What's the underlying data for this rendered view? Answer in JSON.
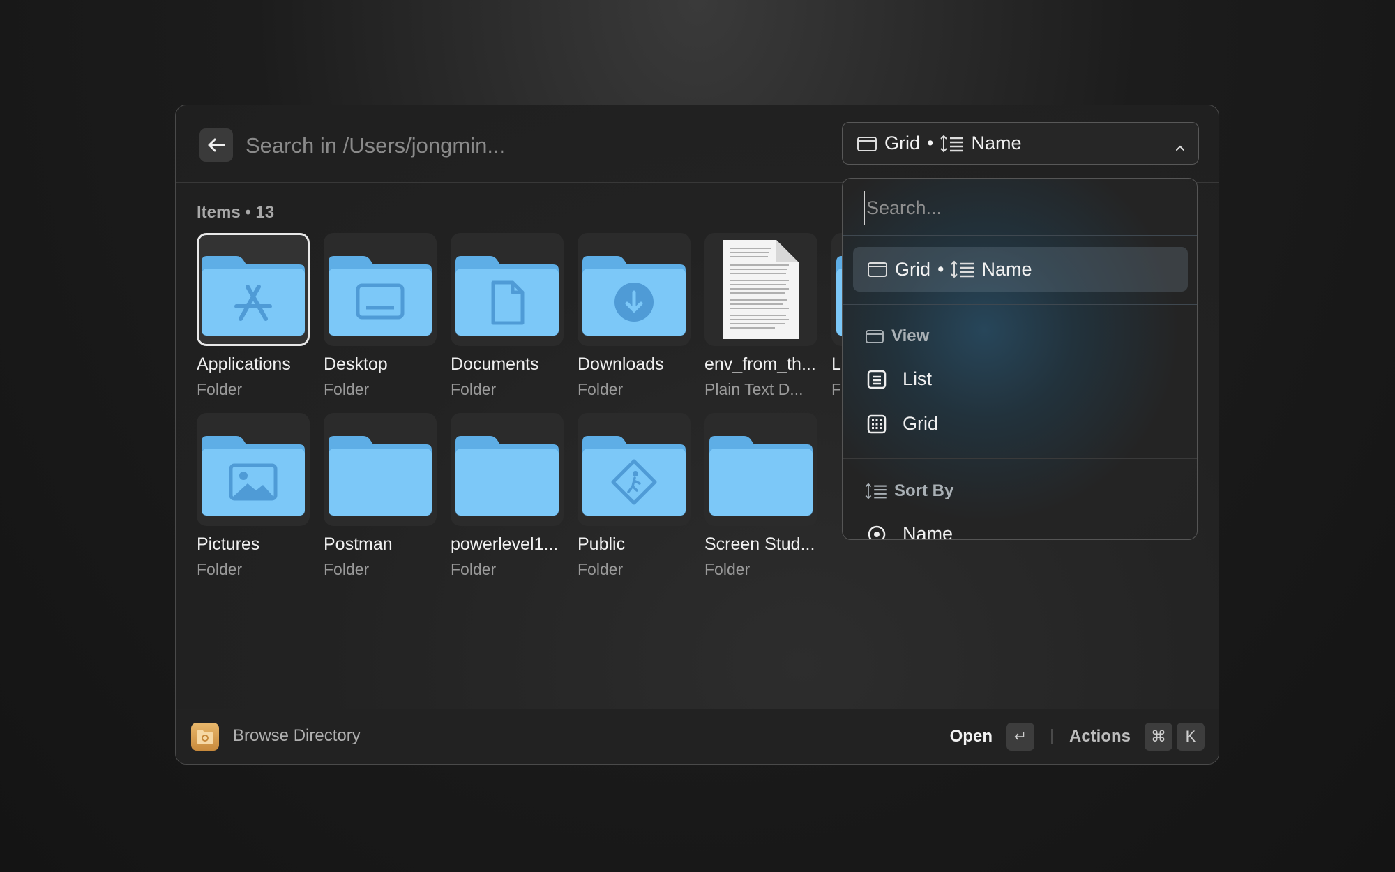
{
  "header": {
    "search_placeholder": "Search in /Users/jongmin...",
    "dropdown": {
      "view": "Grid",
      "separator": "•",
      "sort": "Name"
    }
  },
  "items_count_label": "Items • 13",
  "items": [
    {
      "name": "Applications",
      "kind": "Folder",
      "icon": "applications-folder-icon",
      "selected": true
    },
    {
      "name": "Desktop",
      "kind": "Folder",
      "icon": "desktop-folder-icon"
    },
    {
      "name": "Documents",
      "kind": "Folder",
      "icon": "documents-folder-icon"
    },
    {
      "name": "Downloads",
      "kind": "Folder",
      "icon": "downloads-folder-icon"
    },
    {
      "name": "env_from_th...",
      "kind": "Plain Text D...",
      "icon": "text-document-icon"
    },
    {
      "name": "L",
      "kind": "F",
      "icon": "folder-icon"
    },
    {
      "name": "Pictures",
      "kind": "Folder",
      "icon": "pictures-folder-icon"
    },
    {
      "name": "Postman",
      "kind": "Folder",
      "icon": "folder-icon"
    },
    {
      "name": "powerlevel1...",
      "kind": "Folder",
      "icon": "folder-icon"
    },
    {
      "name": "Public",
      "kind": "Folder",
      "icon": "public-folder-icon"
    },
    {
      "name": "Screen Stud...",
      "kind": "Folder",
      "icon": "folder-icon"
    }
  ],
  "dropdown_panel": {
    "search_placeholder": "Search...",
    "selected": {
      "view": "Grid",
      "separator": "•",
      "sort": "Name"
    },
    "view_section": "View",
    "view_options": [
      "List",
      "Grid"
    ],
    "sort_section": "Sort By",
    "sort_options": [
      "Name"
    ]
  },
  "footer": {
    "title": "Browse Directory",
    "open_label": "Open",
    "enter_key": "↵",
    "actions_label": "Actions",
    "cmd_key": "⌘",
    "k_key": "K"
  },
  "colors": {
    "folder": "#7cc8f8",
    "folder_dark": "#5eaee6",
    "accent_folder_footer": "#d9a15a"
  }
}
